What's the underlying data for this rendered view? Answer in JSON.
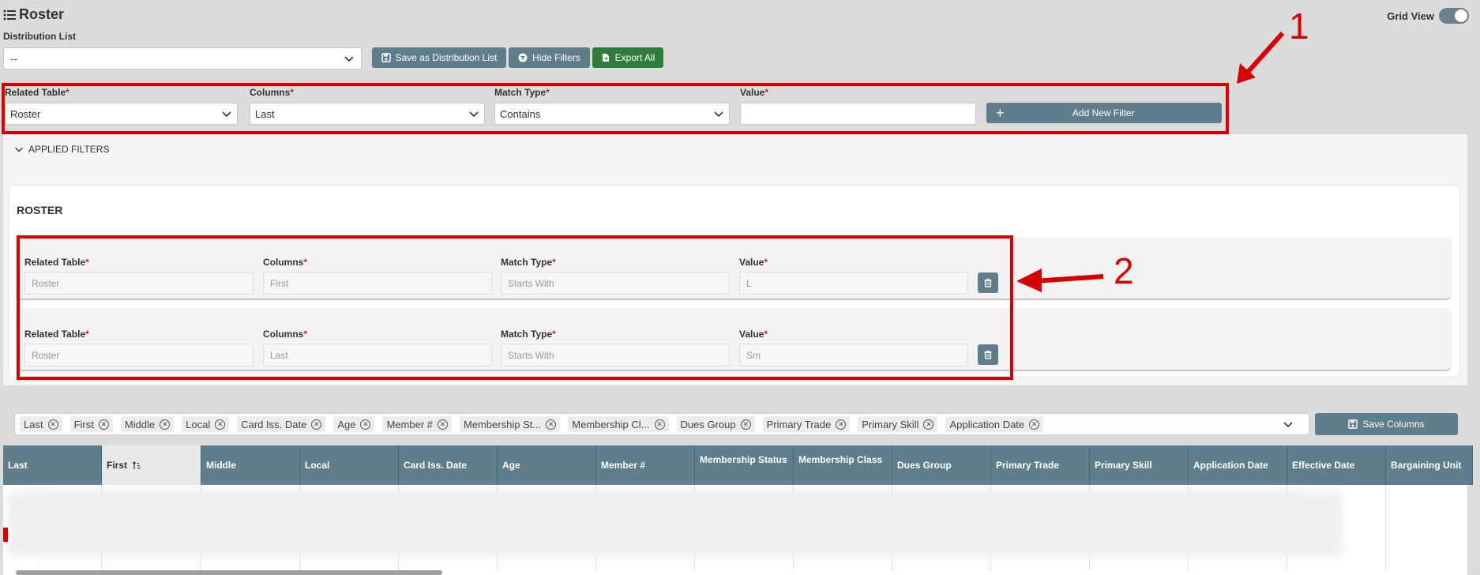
{
  "header": {
    "title": "Roster",
    "grid_view_label": "Grid View"
  },
  "distribution": {
    "label": "Distribution List",
    "value": "--"
  },
  "toolbar": {
    "save_dist_label": "Save as Distribution List",
    "hide_filters_label": "Hide Filters",
    "export_all_label": "Export All"
  },
  "new_filter": {
    "related_table_label": "Related Table",
    "related_table_value": "Roster",
    "columns_label": "Columns",
    "columns_value": "Last",
    "match_type_label": "Match Type",
    "match_type_value": "Contains",
    "value_label": "Value",
    "value_value": "",
    "add_label": "Add New Filter"
  },
  "applied_filters": {
    "header": "APPLIED FILTERS",
    "section_title": "ROSTER",
    "rows": [
      {
        "related_table_label": "Related Table",
        "related_table": "Roster",
        "columns_label": "Columns",
        "columns": "First",
        "match_type_label": "Match Type",
        "match_type": "Starts With",
        "value_label": "Value",
        "value": "L"
      },
      {
        "related_table_label": "Related Table",
        "related_table": "Roster",
        "columns_label": "Columns",
        "columns": "Last",
        "match_type_label": "Match Type",
        "match_type": "Starts With",
        "value_label": "Value",
        "value": "Sm"
      }
    ]
  },
  "annotations": {
    "one": "1",
    "two": "2"
  },
  "column_chips": [
    "Last",
    "First",
    "Middle",
    "Local",
    "Card Iss. Date",
    "Age",
    "Member #",
    "Membership St...",
    "Membership Cl...",
    "Dues Group",
    "Primary Trade",
    "Primary Skill",
    "Application Date"
  ],
  "save_columns_label": "Save Columns",
  "table": {
    "headers": [
      "Last",
      "First",
      "Middle",
      "Local",
      "Card Iss. Date",
      "Age",
      "Member #",
      "Membership Status",
      "Membership Class",
      "Dues Group",
      "Primary Trade",
      "Primary Skill",
      "Application Date",
      "Effective Date",
      "Bargaining Unit"
    ],
    "sorted_column": "First"
  },
  "colors": {
    "accent": "#607d8b",
    "export": "#2e7d3a",
    "annotation": "#d50000"
  }
}
